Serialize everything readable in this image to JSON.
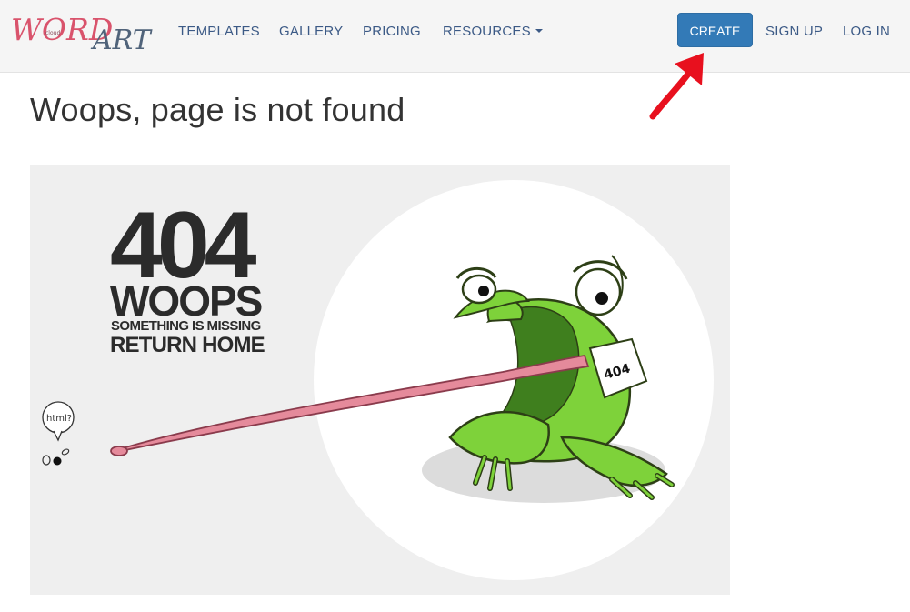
{
  "brand": {
    "logo_word": "WORD",
    "logo_art": "ART",
    "logo_small": "cloud"
  },
  "nav": {
    "templates": "TEMPLATES",
    "gallery": "GALLERY",
    "pricing": "PRICING",
    "resources": "RESOURCES",
    "create": "CREATE",
    "sign_up": "SIGN UP",
    "log_in": "LOG IN"
  },
  "page": {
    "title": "Woops, page is not found"
  },
  "illustration": {
    "code": "404",
    "headline": "WOOPS",
    "subline": "SOMETHING IS MISSING",
    "link": "RETURN HOME",
    "bubble": "html?",
    "tag": "404"
  },
  "colors": {
    "nav_bg": "#f5f5f5",
    "nav_link": "#3c5a86",
    "create_bg": "#337ab7",
    "arrow": "#e8101e",
    "frog": "#7ed23a",
    "tongue": "#e58a9b"
  }
}
